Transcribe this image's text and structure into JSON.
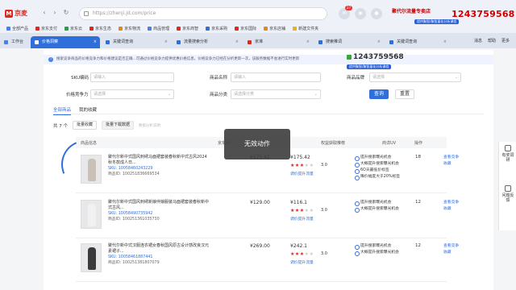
{
  "browser": {
    "app_name": "京麦",
    "url": "https://zhenji.jd.com/price",
    "notification_count": "27",
    "vendor_name": "聚代尔流量专卖店",
    "vendor_phone": "1243759568",
    "vendor_sub": "提供聚智/聚智量化分析课程",
    "bookmarks": [
      "全部产品",
      "京东支付",
      "京东云",
      "京东生态",
      "京东物流",
      "商品管理",
      "京东商智",
      "京东采购",
      "京东国际",
      "京东店铺",
      "新建文件夹"
    ],
    "tabs": [
      {
        "label": "工作台",
        "color": "#4a7ee8"
      },
      {
        "label": "价格洞察",
        "color": "#4a7ee8",
        "active": true
      },
      {
        "label": "关键词查询",
        "color": "#2f6fdc"
      },
      {
        "label": "流量搜索分析",
        "color": "#2f6fdc"
      },
      {
        "label": "京准",
        "color": "#e0281c"
      },
      {
        "label": "搜索推词",
        "color": "#2f6fdc"
      },
      {
        "label": "关键词查询",
        "color": "#2f6fdc"
      }
    ],
    "tabs_right": [
      "消息",
      "帮助",
      "更多"
    ]
  },
  "page": {
    "tip": "搜索竞争商品的价格竞争力和价格建议是否正确...可通过价格竞争力提供优惠价格信息，价格竞争力已经在分析更新一次，该服务数据不会进行实时更新",
    "overlay_phone": "1243759568",
    "overlay_sub": "提供聚智/聚智量化分析课程",
    "filters": {
      "sku_label": "SKU编码",
      "sku_placeholder": "请输入",
      "name_label": "商品名称",
      "name_placeholder": "请输入",
      "brand_label": "商品品牌",
      "brand_placeholder": "请选择",
      "price_label": "价格竞争力",
      "price_placeholder": "请选择",
      "category_label": "商品分类",
      "category_placeholder": "请选择分类"
    },
    "search_label": "查询",
    "reset_label": "重置",
    "subtabs": [
      "全部商品",
      "我的收藏"
    ],
    "toolbar": {
      "count": "共 7 个",
      "batch_fav": "批量收藏",
      "batch_export": "批量下载数据",
      "hint": "数据分析说明"
    },
    "columns": [
      "商品信息",
      "京东价",
      "排行价格",
      "权益获取推荐",
      "商详UV",
      "操作"
    ],
    "rows": [
      {
        "title": "聚代尔新中式国风刺绣马面裙套装春秋新中式古风2024秋冬款成人日...",
        "sku1": "SKU: 10058460243229",
        "sku2": "商品ID: 100251836669534",
        "jd_price": "¥175.42",
        "rank_price": "¥175.42",
        "score": "3.0",
        "stars_on": 3,
        "rank_link": "调价提升流量",
        "tips": [
          "提升搜索曝光机会",
          "大概提升搜索曝光机会",
          "6O天最低价标签",
          "降价幅度大于20%标签"
        ],
        "uv": "18",
        "ops": [
          "查看竞争",
          "收藏"
        ],
        "fig_color": "#c9c1b5"
      },
      {
        "title": "聚代尔新中式国风刺绣新娘伴娘服装马面裙套装春秋新中式古风...",
        "sku1": "SKU: 10058490735942",
        "sku2": "商品ID: 100251361035730",
        "jd_price": "¥129.00",
        "rank_price": "¥116.1",
        "score": "3.0",
        "stars_on": 3,
        "rank_link": "调价提升流量",
        "tips": [
          "提升搜索曝光机会",
          "大概提升搜索曝光机会"
        ],
        "uv": "12",
        "ops": [
          "查看竞争",
          "收藏"
        ],
        "fig_color": "#f1f1f1"
      },
      {
        "title": "聚代尔新中式汉服连衣裙女春秋国风原古设计感改良汉元素裙子...",
        "sku1": "SKU: 10058461887441",
        "sku2": "商品ID: 100251381807079",
        "jd_price": "¥269.00",
        "rank_price": "¥242.1",
        "score": "3.0",
        "stars_on": 3,
        "rank_link": "调价提升流量",
        "tips": [
          "提升搜索曝光机会",
          "大概提升搜索曝光机会"
        ],
        "uv": "12",
        "ops": [
          "查看竞争",
          "收藏"
        ],
        "fig_color": "#3a3a3a"
      }
    ],
    "toast": "无效动作",
    "rail": [
      "有奖调研",
      "问题反馈"
    ]
  }
}
